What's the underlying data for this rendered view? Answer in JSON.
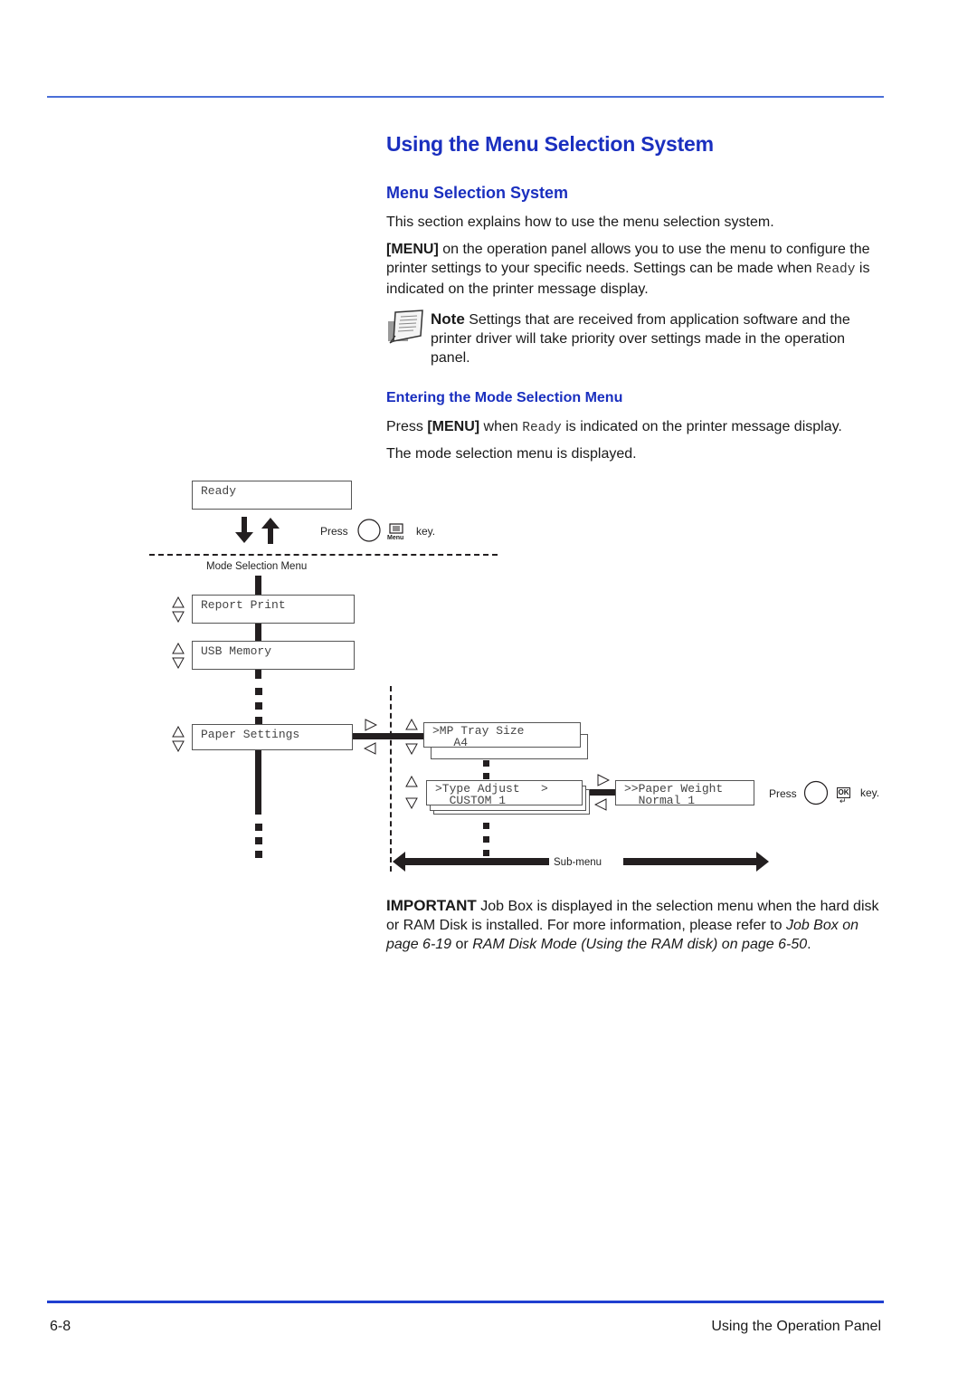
{
  "page": {
    "title": "Using the Menu Selection System",
    "section_title": "Menu Selection System",
    "intro": "This section explains how to use the menu selection system.",
    "menu_para": {
      "key": "[MENU]",
      "text1": " on the operation panel allows you to use the menu to configure the printer settings to your specific needs. Settings can be made when ",
      "ready": "Ready",
      "text2": " is indicated on the printer message display."
    },
    "note": {
      "label": "Note",
      "text": "  Settings that are received from application software and the printer driver will take priority over settings made in the operation panel.",
      "icon": "note-paper-icon"
    },
    "subsection_title": "Entering the Mode Selection Menu",
    "press_para": {
      "prefix": "Press ",
      "key": "[MENU]",
      "mid": " when ",
      "ready": "Ready",
      "suffix": " is indicated on the printer message display."
    },
    "displayed": "The mode selection menu is displayed.",
    "important": {
      "label": "IMPORTANT",
      "text1": "  Job Box is displayed in the selection menu when the hard disk or RAM Disk is installed. For more information, please refer to ",
      "link1": "Job Box on page 6-19",
      "text2": " or ",
      "link2": "RAM Disk Mode (Using the RAM disk) on page 6-50",
      "text3": "."
    }
  },
  "diagram": {
    "ready_display": "Ready",
    "press_label": "Press",
    "key_label": "key.",
    "menu_key_caption": "Menu",
    "mode_selection_label": "Mode Selection Menu",
    "menu_items": [
      "Report Print",
      "USB Memory",
      "Paper Settings"
    ],
    "submenu": {
      "mp_tray": [
        "&gt;MP Tray Size",
        "   A4"
      ],
      "mp_tray_line1": ">MP Tray Size",
      "mp_tray_line2": "   A4",
      "type_adjust_line1": ">Type Adjust   >",
      "type_adjust_line2": "  CUSTOM 1",
      "paper_weight_line1": ">>Paper Weight",
      "paper_weight_line2": "  Normal 1"
    },
    "ok_key_caption": "OK",
    "submenu_label": "Sub-menu"
  },
  "footer": {
    "page_number": "6-8",
    "chapter": "Using the Operation Panel"
  }
}
